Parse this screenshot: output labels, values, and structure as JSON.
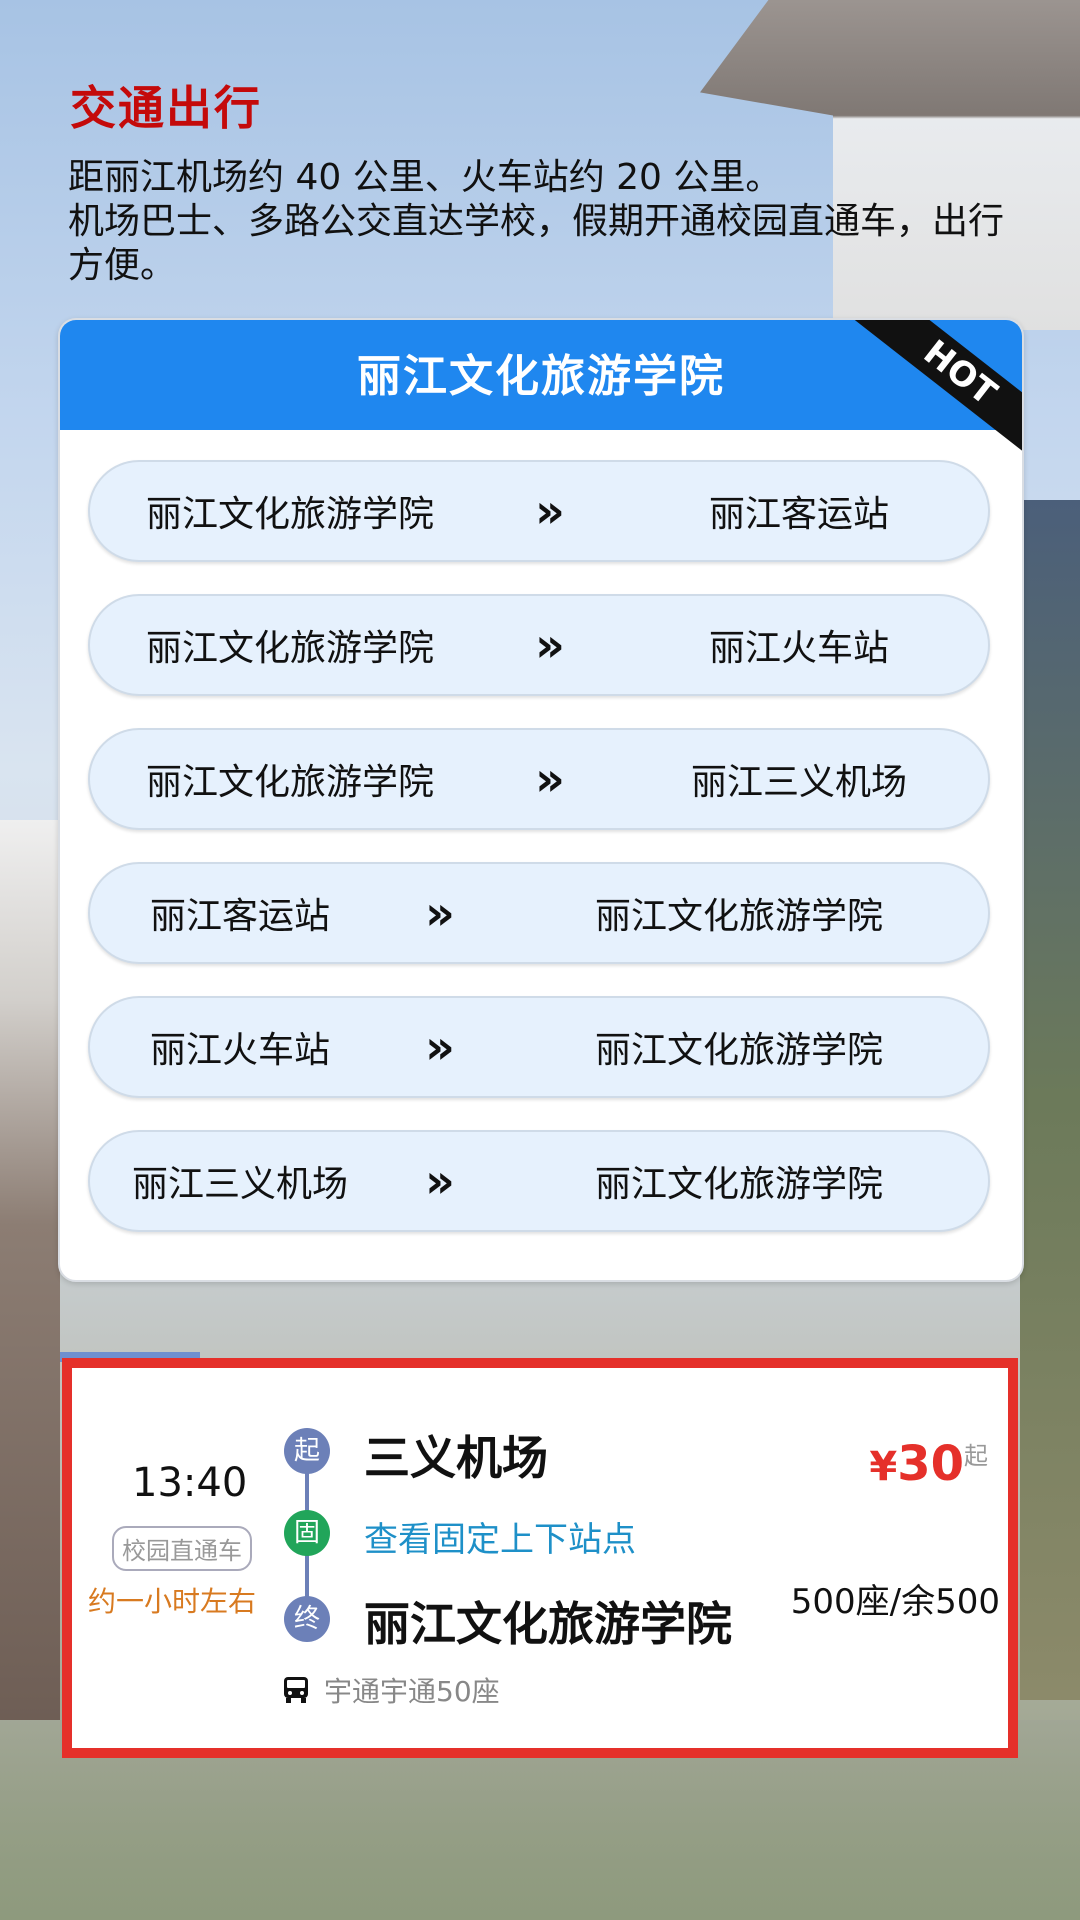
{
  "section": {
    "title": "交通出行",
    "lines": [
      "距丽江机场约 40 公里、火车站约 20 公里。",
      "机场巴士、多路公交直达学校，假期开通校园直通车，出行方便。"
    ]
  },
  "route_card": {
    "title": "丽江文化旅游学院",
    "hot_label": "HOT",
    "arrow": "»",
    "routes": [
      {
        "from": "丽江文化旅游学院",
        "to": "丽江客运站"
      },
      {
        "from": "丽江文化旅游学院",
        "to": "丽江火车站"
      },
      {
        "from": "丽江文化旅游学院",
        "to": "丽江三义机场"
      },
      {
        "from": "丽江客运站",
        "to": "丽江文化旅游学院"
      },
      {
        "from": "丽江火车站",
        "to": "丽江文化旅游学院"
      },
      {
        "from": "丽江三义机场",
        "to": "丽江文化旅游学院"
      }
    ]
  },
  "ticket": {
    "time": "13:40",
    "type": "校园直通车",
    "duration": "约一小时左右",
    "start_marker": "起",
    "start": "三义机场",
    "fixed_marker": "固",
    "fixed_link": "查看固定上下站点",
    "end_marker": "终",
    "end": "丽江文化旅游学院",
    "vehicle": "宇通宇通50座",
    "price_currency": "¥",
    "price_amount": "30",
    "price_suffix": "起",
    "seats": "500座/余500"
  },
  "colors": {
    "heading": "#c40a0a",
    "header_blue": "#1f87ef",
    "route_bg": "#e6f1fd",
    "ticket_border": "#e5302a",
    "marker_blue": "#6c80b8",
    "marker_green": "#21a55a",
    "link_blue": "#1e90c8",
    "duration_orange": "#d87a20"
  }
}
